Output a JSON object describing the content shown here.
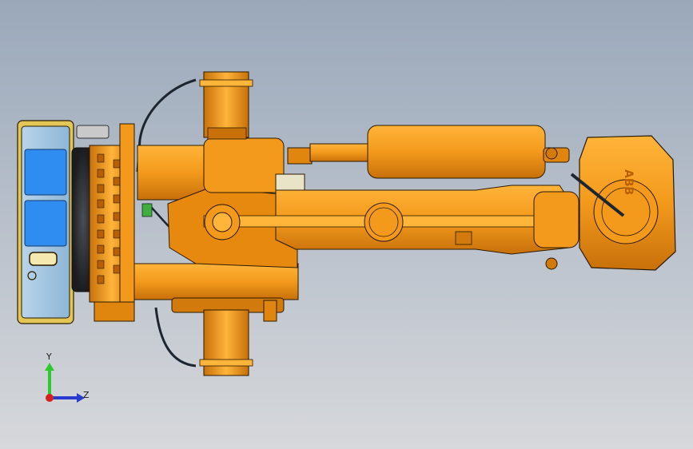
{
  "viewport": {
    "background_top": "#9aa8ba",
    "background_bottom": "#d6d8db"
  },
  "model": {
    "body_color": "#f39a1c",
    "shadow_color": "#d97f0a",
    "highlight_color": "#ffc04d",
    "edge_color": "#2a1a00",
    "panel_color": "#9ec3df",
    "screen_color": "#2f8cf0",
    "frame_color": "#e8d06a",
    "logo_text": "ABB"
  },
  "triad": {
    "x_label": "",
    "y_label": "Y",
    "z_label": "Z",
    "y_color": "#2ec92e",
    "z_color": "#2a3ccf",
    "x_color": "#d62020"
  }
}
